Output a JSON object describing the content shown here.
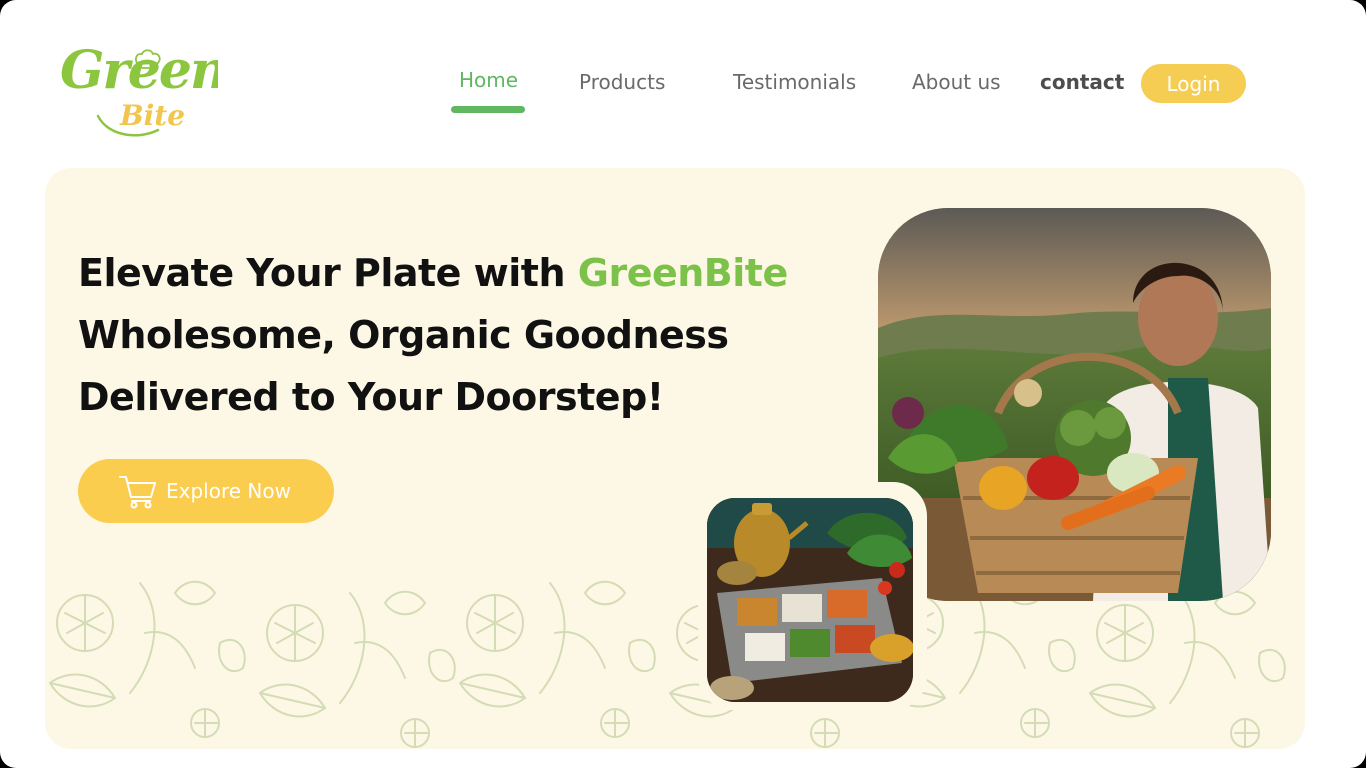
{
  "logo": {
    "word_green": "Green",
    "word_bite": "Bite",
    "icon": "chef-hat-icon"
  },
  "nav": {
    "items": [
      {
        "label": "Home",
        "active": true
      },
      {
        "label": "Products",
        "active": false
      },
      {
        "label": "Testimonials",
        "active": false
      },
      {
        "label": "About us",
        "active": false
      },
      {
        "label": "contact",
        "active": false
      }
    ],
    "login_label": "Login"
  },
  "hero": {
    "headline_line1_prefix": "Elevate Your Plate with ",
    "headline_brand": "GreenBite",
    "headline_line2": "Wholesome, Organic Goodness",
    "headline_line3": "Delivered to Your Doorstep!",
    "cta_label": "Explore Now",
    "cta_icon": "shopping-cart-icon",
    "main_image": "woman-holding-vegetable-basket-photo",
    "small_image": "indian-spices-and-vegetables-table-photo"
  },
  "colors": {
    "brand_green": "#7cc24a",
    "nav_active": "#5fb760",
    "accent_yellow": "#fbcd4e",
    "hero_bg": "#fdf8e6",
    "pattern_stroke": "#cfd8b0"
  }
}
